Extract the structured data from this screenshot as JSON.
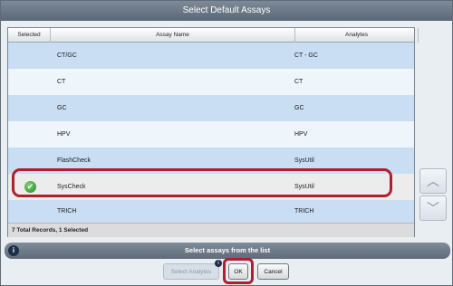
{
  "window": {
    "title": "Select Default Assays"
  },
  "table": {
    "headers": {
      "selected": "Selected",
      "assay_name": "Assay Name",
      "analytes": "Analytes"
    },
    "rows": [
      {
        "name": "CT/GC",
        "analytes": "CT - GC",
        "selected": false
      },
      {
        "name": "CT",
        "analytes": "CT",
        "selected": false
      },
      {
        "name": "GC",
        "analytes": "GC",
        "selected": false
      },
      {
        "name": "HPV",
        "analytes": "HPV",
        "selected": false
      },
      {
        "name": "FlashCheck",
        "analytes": "SysUtil",
        "selected": false
      },
      {
        "name": "SysCheck",
        "analytes": "SysUtil",
        "selected": true
      },
      {
        "name": "TRICH",
        "analytes": "TRICH",
        "selected": false
      }
    ],
    "footer": "7 Total Records, 1 Selected"
  },
  "scrollbar": {
    "up_icon": "chevron-up-icon",
    "down_icon": "chevron-down-icon"
  },
  "status": {
    "icon": "info-icon",
    "glyph": "i",
    "text": "Select assays from the list"
  },
  "buttons": {
    "select_analytes": "Select Analytes",
    "select_analytes_enabled": false,
    "badge_glyph": "i",
    "ok": "OK",
    "cancel": "Cancel"
  },
  "colors": {
    "highlight": "#b01f2e",
    "row_blue": "#c9def3",
    "row_light": "#eef5fb",
    "titlebar": "#6b7786"
  }
}
